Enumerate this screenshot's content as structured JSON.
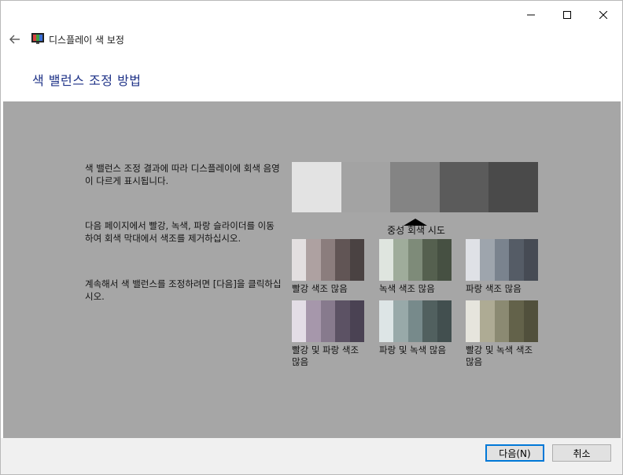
{
  "window": {
    "title": "디스플레이 색 보정",
    "heading": "색 밸런스 조정 방법"
  },
  "instructions": [
    "색 밸런스 조정 결과에 따라 디스플레이에 회색 음영이 다르게 표시됩니다.",
    "다음 페이지에서 빨강, 녹색, 파랑 슬라이더를 이동하여 회색 막대에서 색조를 제거하십시오.",
    "계속해서 색 밸런스를 조정하려면 [다음]을 클릭하십시오."
  ],
  "neutral": {
    "label": "중성 회색 시도",
    "colors": [
      "#e3e3e3",
      "#a3a3a3",
      "#848484",
      "#5b5b5b",
      "#4a4a4a"
    ]
  },
  "swatches": [
    {
      "label": "빨강 색조 많음",
      "colors": [
        "#e3dfe0",
        "#aea1a1",
        "#8b7d7d",
        "#615555",
        "#4a4242"
      ]
    },
    {
      "label": "녹색 색조 많음",
      "colors": [
        "#dfe5df",
        "#9fac9b",
        "#7e8b79",
        "#55604f",
        "#465042"
      ]
    },
    {
      "label": "파랑 색조 많음",
      "colors": [
        "#dfe1e6",
        "#9ea5ad",
        "#7a838e",
        "#555c66",
        "#464b54"
      ]
    },
    {
      "label": "빨강 및 파랑 색조 많음",
      "colors": [
        "#e3dde6",
        "#a697ab",
        "#877a8d",
        "#5c5264",
        "#4a4253"
      ]
    },
    {
      "label": "파랑 및 녹색 많음",
      "colors": [
        "#dde5e6",
        "#98a9a9",
        "#778a8b",
        "#51605f",
        "#424f4f"
      ]
    },
    {
      "label": "빨강 및 녹색 색조 많음",
      "colors": [
        "#e6e5dd",
        "#aeab94",
        "#8b8a72",
        "#63624a",
        "#51503c"
      ]
    }
  ],
  "buttons": {
    "next": "다음(N)",
    "cancel": "취소"
  },
  "colors": {
    "panel": "#a6a6a6",
    "heading": "#1e3287",
    "accent": "#0078d7"
  }
}
